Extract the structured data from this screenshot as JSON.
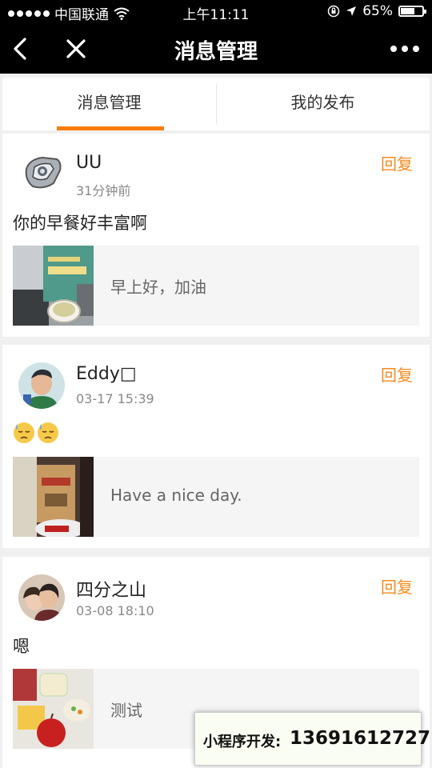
{
  "status_bar": {
    "carrier": "中国联通",
    "time": "上午11:11",
    "battery_percent": "65%",
    "battery_level": 0.65
  },
  "nav": {
    "title": "消息管理",
    "back_icon": "back-arrow-icon",
    "close_icon": "close-icon",
    "more_icon": "more-dots-icon"
  },
  "tabs": [
    {
      "label": "消息管理",
      "active": true
    },
    {
      "label": "我的发布",
      "active": false
    }
  ],
  "accent_color": "#f97d0a",
  "messages": [
    {
      "username": "UU",
      "time": "31分钟前",
      "reply_label": "回复",
      "content": "你的早餐好丰富啊",
      "quote_text": "早上好，加油"
    },
    {
      "username": "Eddy□",
      "time": "03-17 15:39",
      "reply_label": "回复",
      "content": "",
      "content_emoji": [
        "sweat-face-emoji",
        "sweat-face-emoji"
      ],
      "quote_text": "Have a nice day."
    },
    {
      "username": "四分之山",
      "time": "03-08 18:10",
      "reply_label": "回复",
      "content": "嗯",
      "quote_text": "测试"
    }
  ],
  "ad": {
    "label": "小程序开发:",
    "phone": "13691612727"
  }
}
